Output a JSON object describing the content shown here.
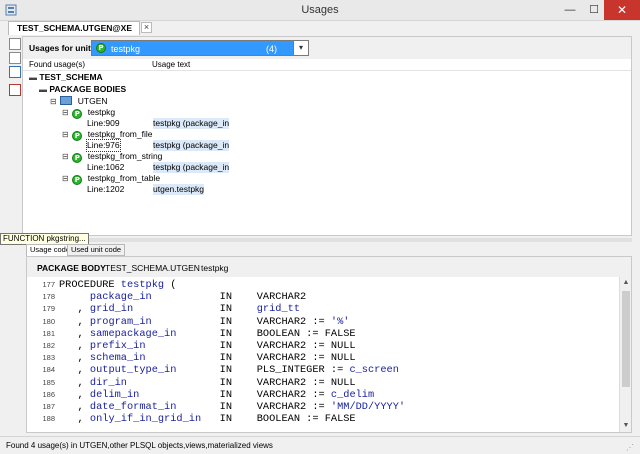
{
  "window": {
    "title": "Usages"
  },
  "tab": {
    "label": "TEST_SCHEMA.UTGEN@XE",
    "close": "×"
  },
  "unit_selector": {
    "label": "Usages for unit :",
    "value": "testpkg",
    "count": "(4)"
  },
  "columns": {
    "found": "Found usage(s)",
    "usage_text": "Usage text"
  },
  "tree": {
    "schema": "TEST_SCHEMA",
    "group": "PACKAGE BODIES",
    "object": "UTGEN",
    "items": [
      {
        "name": "testpkg",
        "line": "Line:909",
        "text": "testpkg (package_in"
      },
      {
        "name": "testpkg_from_file",
        "line": "Line:976",
        "text": "testpkg (package_in"
      },
      {
        "name": "testpkg_from_string",
        "line": "Line:1062",
        "text": "testpkg (package_in"
      },
      {
        "name": "testpkg_from_table",
        "line": "Line:1202",
        "text": "utgen.testpkg"
      }
    ]
  },
  "tooltip": "FUNCTION pkgstring...",
  "bottom_tabs": [
    "Usage code",
    "Used unit code"
  ],
  "body_header": {
    "kind": "PACKAGE BODY",
    "object": "TEST_SCHEMA.UTGEN",
    "unit": "testpkg"
  },
  "code": [
    {
      "num": "177",
      "segs": [
        [
          "PROCEDURE ",
          "kw"
        ],
        [
          "testpkg",
          "id"
        ],
        [
          " (",
          "op"
        ]
      ]
    },
    {
      "num": "178",
      "segs": [
        [
          "     package_in           ",
          "id"
        ],
        [
          "IN    ",
          "kw"
        ],
        [
          "VARCHAR2",
          "kw"
        ]
      ]
    },
    {
      "num": "179",
      "segs": [
        [
          "   , ",
          "op"
        ],
        [
          "grid_in              ",
          "id"
        ],
        [
          "IN    ",
          "kw"
        ],
        [
          "grid_tt",
          "id"
        ]
      ]
    },
    {
      "num": "180",
      "segs": [
        [
          "   , ",
          "op"
        ],
        [
          "program_in           ",
          "id"
        ],
        [
          "IN    ",
          "kw"
        ],
        [
          "VARCHAR2 := ",
          "kw"
        ],
        [
          "'%'",
          "str"
        ]
      ]
    },
    {
      "num": "181",
      "segs": [
        [
          "   , ",
          "op"
        ],
        [
          "samepackage_in       ",
          "id"
        ],
        [
          "IN    ",
          "kw"
        ],
        [
          "BOOLEAN := FALSE",
          "kw"
        ]
      ]
    },
    {
      "num": "182",
      "segs": [
        [
          "   , ",
          "op"
        ],
        [
          "prefix_in            ",
          "id"
        ],
        [
          "IN    ",
          "kw"
        ],
        [
          "VARCHAR2 := NULL",
          "kw"
        ]
      ]
    },
    {
      "num": "183",
      "segs": [
        [
          "   , ",
          "op"
        ],
        [
          "schema_in            ",
          "id"
        ],
        [
          "IN    ",
          "kw"
        ],
        [
          "VARCHAR2 := NULL",
          "kw"
        ]
      ]
    },
    {
      "num": "184",
      "segs": [
        [
          "   , ",
          "op"
        ],
        [
          "output_type_in       ",
          "id"
        ],
        [
          "IN    ",
          "kw"
        ],
        [
          "PLS_INTEGER := ",
          "kw"
        ],
        [
          "c_screen",
          "id"
        ]
      ]
    },
    {
      "num": "185",
      "segs": [
        [
          "   , ",
          "op"
        ],
        [
          "dir_in               ",
          "id"
        ],
        [
          "IN    ",
          "kw"
        ],
        [
          "VARCHAR2 := NULL",
          "kw"
        ]
      ]
    },
    {
      "num": "186",
      "segs": [
        [
          "   , ",
          "op"
        ],
        [
          "delim_in             ",
          "id"
        ],
        [
          "IN    ",
          "kw"
        ],
        [
          "VARCHAR2 := ",
          "kw"
        ],
        [
          "c_delim",
          "id"
        ]
      ]
    },
    {
      "num": "187",
      "segs": [
        [
          "   , ",
          "op"
        ],
        [
          "date_format_in       ",
          "id"
        ],
        [
          "IN    ",
          "kw"
        ],
        [
          "VARCHAR2 := ",
          "kw"
        ],
        [
          "'MM/DD/YYYY'",
          "str"
        ]
      ]
    },
    {
      "num": "188",
      "segs": [
        [
          "   , ",
          "op"
        ],
        [
          "only_if_in_grid_in   ",
          "id"
        ],
        [
          "IN    ",
          "kw"
        ],
        [
          "BOOLEAN := FALSE",
          "kw"
        ]
      ]
    }
  ],
  "status": "Found 4 usage(s) in UTGEN,other PLSQL objects,views,materialized views",
  "icons": {
    "package": "P",
    "window_min": "—",
    "window_max": "☐",
    "window_close": "✕",
    "dropdown": "▾"
  }
}
